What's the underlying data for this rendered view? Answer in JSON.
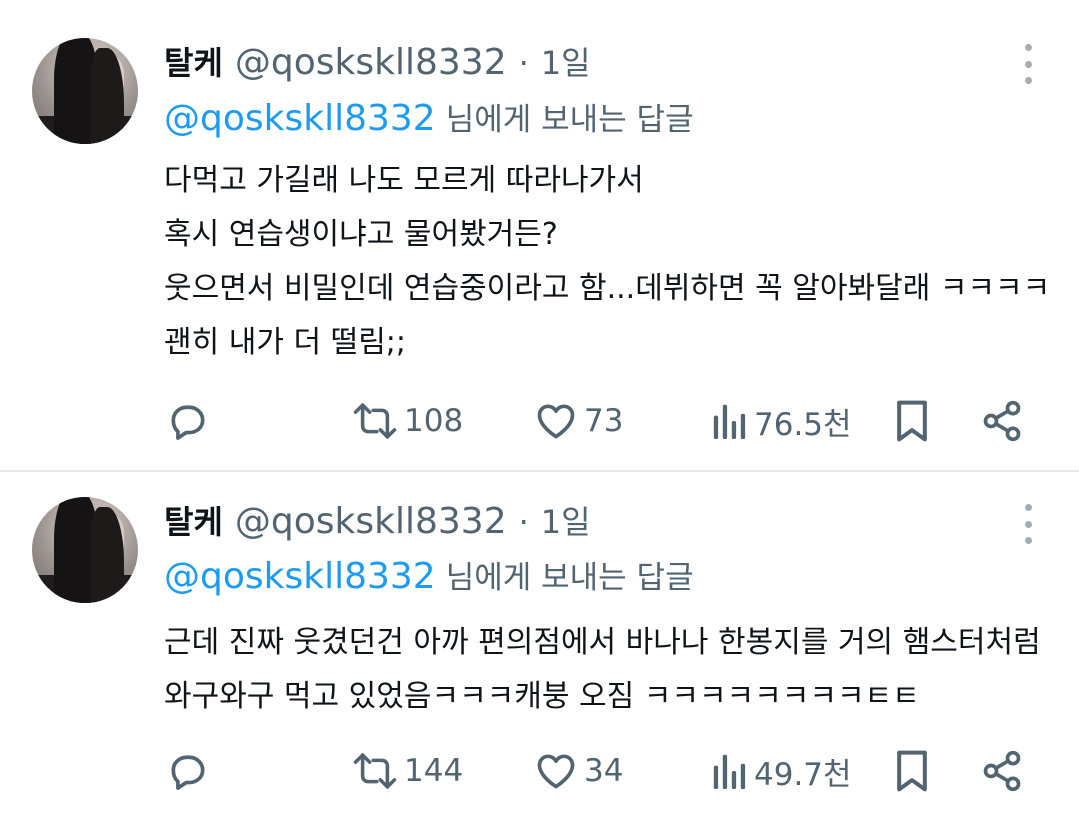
{
  "tweets": [
    {
      "display_name": "탈케",
      "handle": "@qoskskll8332",
      "separator": "·",
      "time": "1일",
      "reply_mention": "@qoskskll8332",
      "reply_suffix": "님에게 보내는 답글",
      "lines": [
        "다먹고 가길래 나도 모르게 따라나가서",
        "혹시 연습생이냐고 물어봤거든?",
        "웃으면서 비밀인데 연습중이라고 함...데뷔하면 꼭 알아봐달래 ㅋㅋㅋㅋ",
        "괜히 내가 더 떨림;;"
      ],
      "retweets": "108",
      "likes": "73",
      "views": "76.5천"
    },
    {
      "display_name": "탈케",
      "handle": "@qoskskll8332",
      "separator": "·",
      "time": "1일",
      "reply_mention": "@qoskskll8332",
      "reply_suffix": "님에게 보내는 답글",
      "lines": [
        "근데 진짜 웃겼던건 아까 편의점에서 바나나 한봉지를 거의 햄스터처럼",
        "와구와구 먹고 있었음ㅋㅋㅋ캐붕 오짐 ㅋㅋㅋㅋㅋㅋㅋㅋㅌㅌ"
      ],
      "retweets": "144",
      "likes": "34",
      "views": "49.7천"
    }
  ],
  "icons": {
    "reply": "reply-icon",
    "retweet": "retweet-icon",
    "like": "heart-icon",
    "views": "views-icon",
    "bookmark": "bookmark-icon",
    "share": "share-icon",
    "more": "more-vertical-icon"
  },
  "colors": {
    "text": "#0f1419",
    "secondary": "#536471",
    "mention": "#1d9bf0",
    "divider": "#e7e9eb"
  }
}
